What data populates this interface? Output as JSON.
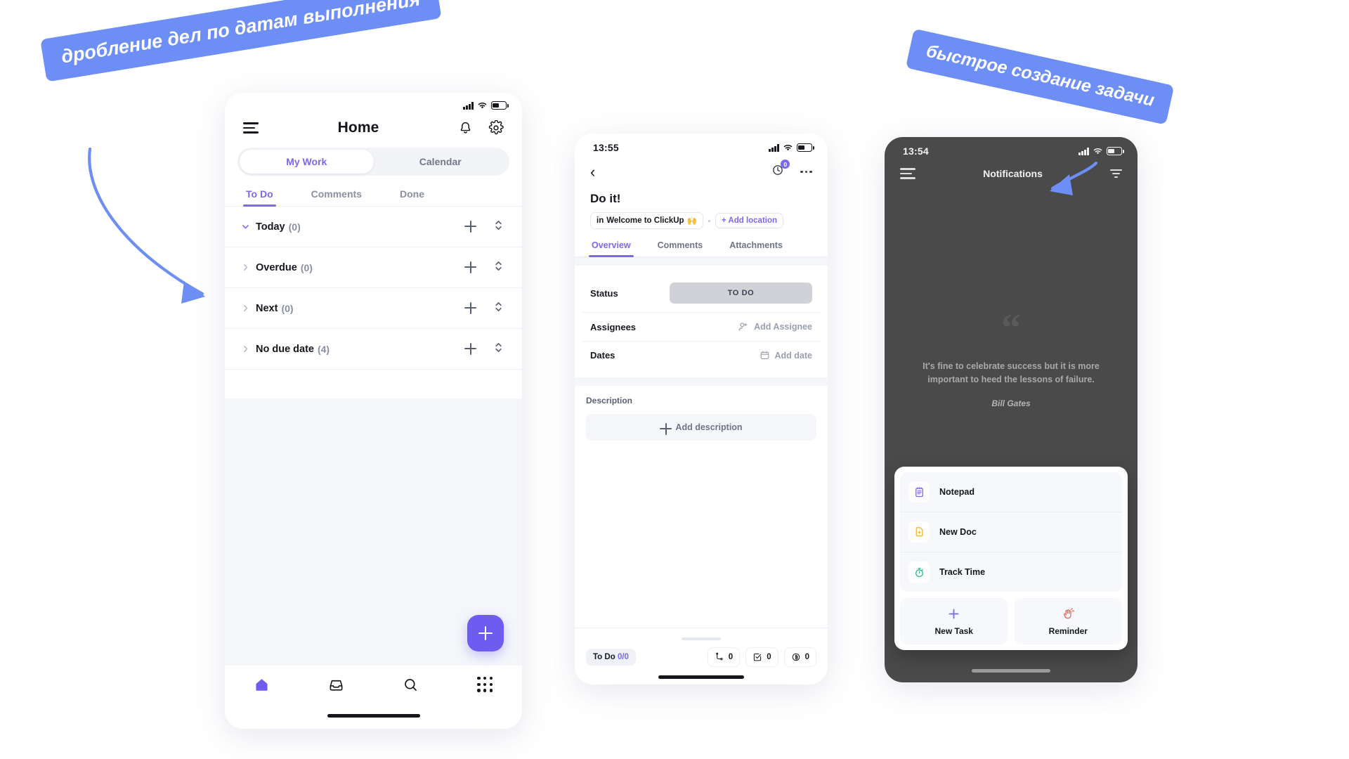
{
  "annotations": [
    {
      "text": "дробление дел по датам выполнения",
      "color": "#6c8ef5"
    },
    {
      "text": "быстрое создание задачи",
      "color": "#6c8ef5"
    }
  ],
  "phone1": {
    "status": {
      "time": "",
      "signal": "signal-icon",
      "wifi": "wifi-icon",
      "battery": "battery-icon"
    },
    "header": {
      "menu": "hamburger-icon",
      "title": "Home",
      "bell": "bell-icon",
      "settings": "gear-icon"
    },
    "segments": [
      {
        "label": "My Work",
        "active": true
      },
      {
        "label": "Calendar",
        "active": false
      }
    ],
    "tabs": [
      {
        "label": "To Do",
        "active": true
      },
      {
        "label": "Comments",
        "active": false
      },
      {
        "label": "Done",
        "active": false
      }
    ],
    "groups": [
      {
        "label": "Today",
        "count": "(0)",
        "expanded": true
      },
      {
        "label": "Overdue",
        "count": "(0)",
        "expanded": false
      },
      {
        "label": "Next",
        "count": "(0)",
        "expanded": false
      },
      {
        "label": "No due date",
        "count": "(4)",
        "expanded": false
      }
    ],
    "fab": "add-button",
    "bottom_nav": [
      {
        "name": "home-icon",
        "active": true
      },
      {
        "name": "inbox-icon",
        "active": false
      },
      {
        "name": "search-icon",
        "active": false
      },
      {
        "name": "apps-grid-icon",
        "active": false
      }
    ]
  },
  "phone2": {
    "status": {
      "time": "13:55"
    },
    "header": {
      "back": "back-chevron-icon",
      "watch": "watchers-icon",
      "watch_count": "0",
      "more": "more-options-icon"
    },
    "task_title": "Do it!",
    "breadcrumb": {
      "prefix": "in",
      "location": "Welcome to ClickUp",
      "emoji": "🙌",
      "add_location": "+ Add location"
    },
    "tabs": [
      {
        "label": "Overview",
        "active": true
      },
      {
        "label": "Comments",
        "active": false
      },
      {
        "label": "Attachments",
        "active": false
      }
    ],
    "properties": [
      {
        "label": "Status",
        "value": "TO DO",
        "type": "pill"
      },
      {
        "label": "Assignees",
        "value": "Add Assignee",
        "type": "action",
        "icon": "add-person-icon"
      },
      {
        "label": "Dates",
        "value": "Add date",
        "type": "action",
        "icon": "calendar-icon"
      }
    ],
    "description": {
      "title": "Description",
      "add_label": "Add description"
    },
    "footer": {
      "todo_label": "To Do",
      "todo_count": "0/0",
      "counters": [
        {
          "icon": "subtask-icon",
          "value": "0"
        },
        {
          "icon": "checklist-icon",
          "value": "0"
        },
        {
          "icon": "attachment-icon",
          "value": "0"
        }
      ]
    }
  },
  "phone3": {
    "status": {
      "time": "13:54"
    },
    "header": {
      "menu": "hamburger-icon",
      "title": "Notifications",
      "filter": "filter-icon"
    },
    "quote": {
      "mark": "“",
      "text": "It's fine to celebrate success but it is more important to heed the lessons of failure.",
      "author": "Bill Gates"
    },
    "sheet": {
      "items": [
        {
          "label": "Notepad",
          "icon": "notepad-icon",
          "color": "#7b68ee"
        },
        {
          "label": "New Doc",
          "icon": "new-doc-icon",
          "color": "#f5c84c"
        },
        {
          "label": "Track Time",
          "icon": "stopwatch-icon",
          "color": "#2fb886"
        }
      ],
      "actions": [
        {
          "label": "New Task",
          "icon": "plus-icon",
          "color": "#7b68ee"
        },
        {
          "label": "Reminder",
          "icon": "reminder-hand-icon",
          "color": "#f4654f"
        }
      ]
    }
  }
}
